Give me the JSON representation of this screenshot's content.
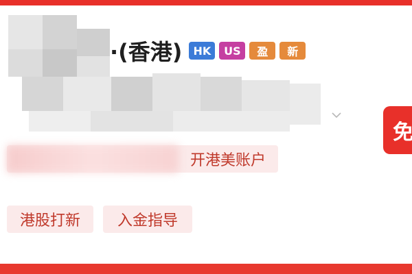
{
  "account": {
    "title_suffix": "·(香港)",
    "tags": {
      "hk": "HK",
      "us": "US",
      "ib": "盈",
      "new": "新"
    },
    "account_type_label": "开港美账户"
  },
  "side_button": {
    "label": "免"
  },
  "chips": {
    "ipo": "港股打新",
    "deposit": "入金指导"
  },
  "colors": {
    "brand_red": "#e8302a",
    "tag_hk": "#3b7bd8",
    "tag_us": "#c53fa1",
    "tag_orange": "#e58a3b",
    "chip_bg": "#fbeaea",
    "chip_text": "#c0392b"
  }
}
